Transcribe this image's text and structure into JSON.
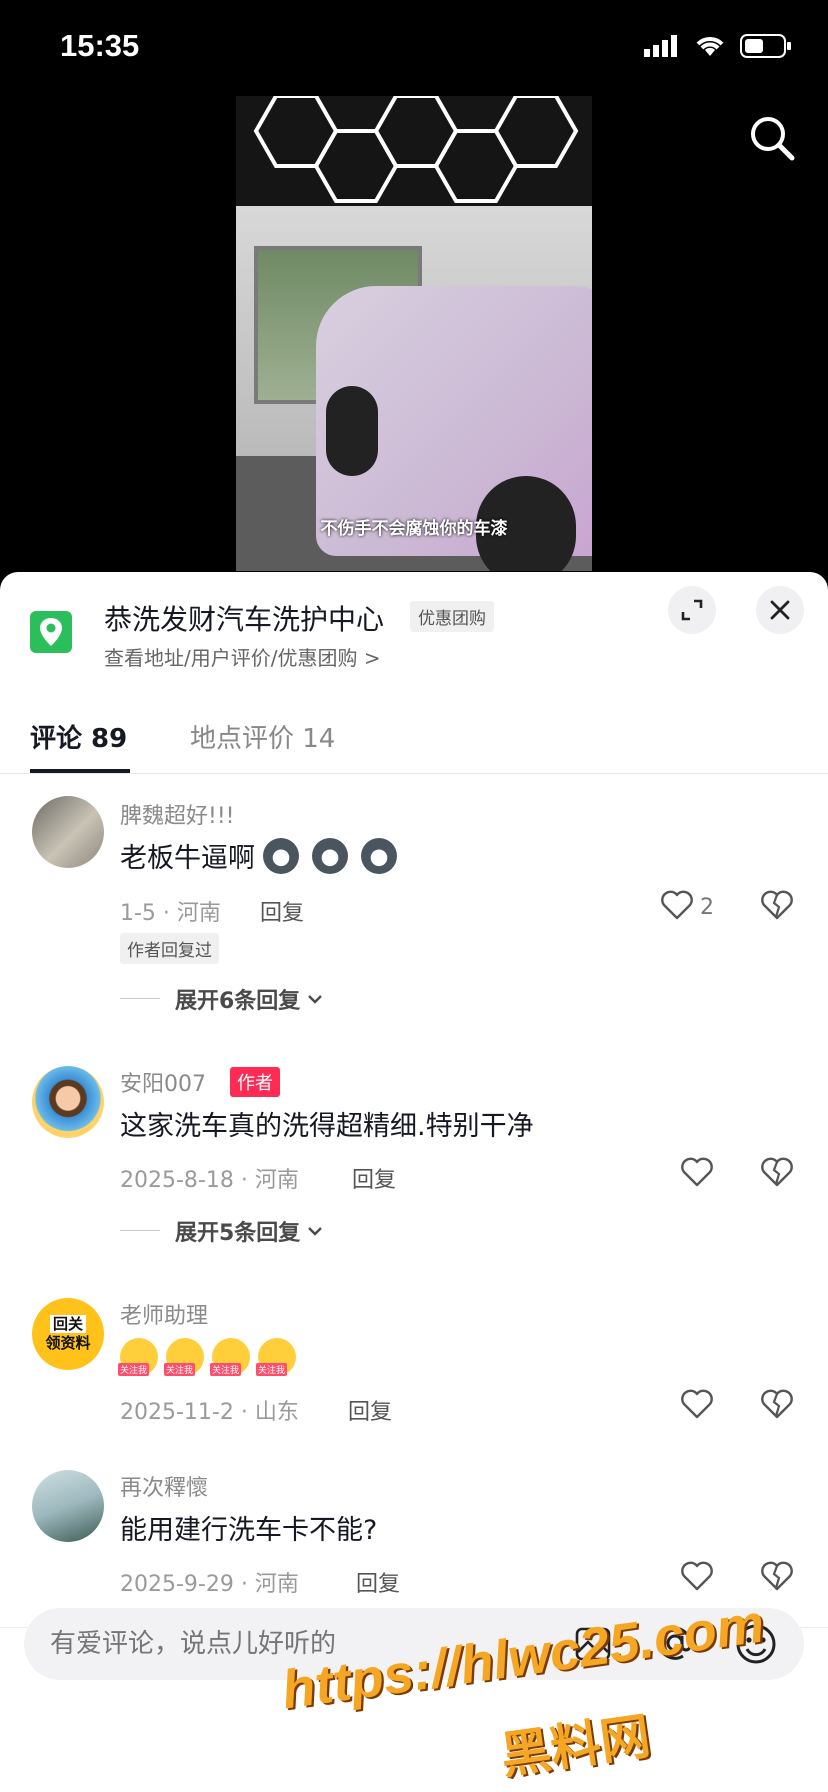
{
  "status_bar": {
    "time": "15:35"
  },
  "video": {
    "subtitle": "不伤手不会腐蚀你的车漆"
  },
  "poi": {
    "title": "恭洗发财汽车洗护中心",
    "badge": "优惠团购",
    "subtitle": "查看地址/用户评价/优惠团购 >"
  },
  "tabs": [
    {
      "label": "评论 89",
      "active": true
    },
    {
      "label": "地点评价 14",
      "active": false
    }
  ],
  "comments": [
    {
      "username": "脾魏超好!!!",
      "text": "老板牛逼啊",
      "emoji_count": 3,
      "date_loc": "1-5 · 河南",
      "reply": "回复",
      "likes": "2",
      "tag": "作者回复过",
      "expand": "展开6条回复"
    },
    {
      "username": "安阳007",
      "badge": "作者",
      "text": "这家洗车真的洗得超精细.特别干净",
      "date_loc": "2025-8-18 · 河南",
      "reply": "回复",
      "expand": "展开5条回复"
    },
    {
      "username": "老师助理",
      "avatar_text": [
        "回关",
        "领资料"
      ],
      "emoji_label": "关注我",
      "date_loc": "2025-11-2 · 山东",
      "reply": "回复"
    },
    {
      "username": "再次釋懷",
      "text": "能用建行洗车卡不能?",
      "date_loc": "2025-9-29 · 河南",
      "reply": "回复"
    }
  ],
  "input": {
    "placeholder": "有爱评论，说点儿好听的"
  },
  "watermark": {
    "line1": "https://hlwc25.com",
    "line2": "黑料网"
  },
  "colors": {
    "accent_red": "#fe2c55",
    "poi_green": "#2bbf5c"
  }
}
